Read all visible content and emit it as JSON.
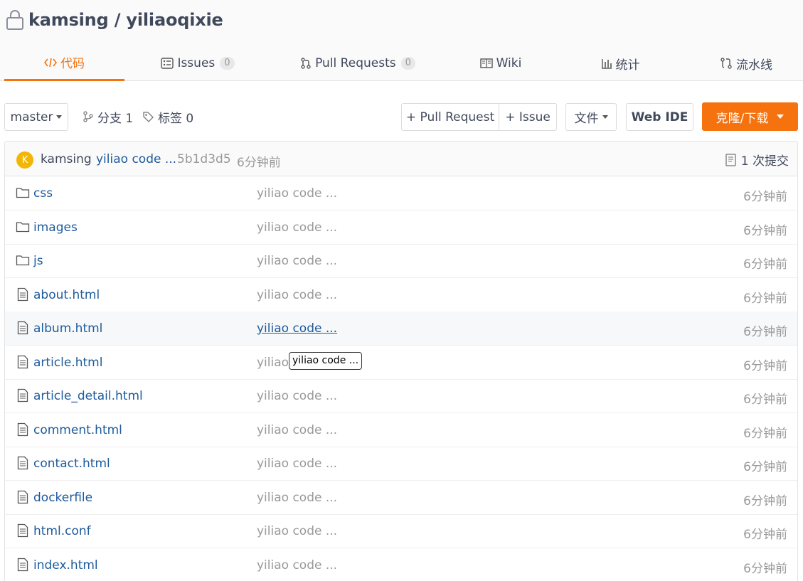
{
  "repo": {
    "title": "kamsing / yiliaoqixie"
  },
  "tabs": [
    {
      "label": "代码",
      "icon": "code-icon",
      "active": true
    },
    {
      "label": "Issues",
      "count": "0",
      "icon": "issues-icon"
    },
    {
      "label": "Pull Requests",
      "count": "0",
      "icon": "pull-request-icon"
    },
    {
      "label": "Wiki",
      "icon": "wiki-icon"
    },
    {
      "label": "统计",
      "icon": "stats-icon"
    },
    {
      "label": "流水线",
      "icon": "pipeline-icon"
    }
  ],
  "toolbar": {
    "branch": "master",
    "branches": "分支 1",
    "tags": "标签 0",
    "new_pr": "+ Pull Request",
    "new_issue": "+ Issue",
    "file": "文件",
    "web_ide": "Web IDE",
    "clone": "克隆/下载"
  },
  "commit": {
    "avatar_letter": "K",
    "author": "kamsing",
    "message": "yiliao code ...",
    "hash": "5b1d3d5",
    "time": "6分钟前",
    "commits": "1 次提交"
  },
  "files": [
    {
      "name": "css",
      "type": "folder",
      "message": "yiliao code ...",
      "time": "6分钟前"
    },
    {
      "name": "images",
      "type": "folder",
      "message": "yiliao code ...",
      "time": "6分钟前"
    },
    {
      "name": "js",
      "type": "folder",
      "message": "yiliao code ...",
      "time": "6分钟前"
    },
    {
      "name": "about.html",
      "type": "file",
      "message": "yiliao code ...",
      "time": "6分钟前"
    },
    {
      "name": "album.html",
      "type": "file",
      "message": "yiliao code ...",
      "time": "6分钟前"
    },
    {
      "name": "article.html",
      "type": "file",
      "message": "yiliao",
      "time": "6分钟前"
    },
    {
      "name": "article_detail.html",
      "type": "file",
      "message": "yiliao code ...",
      "time": "6分钟前"
    },
    {
      "name": "comment.html",
      "type": "file",
      "message": "yiliao code ...",
      "time": "6分钟前"
    },
    {
      "name": "contact.html",
      "type": "file",
      "message": "yiliao code ...",
      "time": "6分钟前"
    },
    {
      "name": "dockerfile",
      "type": "file",
      "message": "yiliao code ...",
      "time": "6分钟前"
    },
    {
      "name": "html.conf",
      "type": "file",
      "message": "yiliao code ...",
      "time": "6分钟前"
    },
    {
      "name": "index.html",
      "type": "file",
      "message": "yiliao code ...",
      "time": "6分钟前"
    }
  ],
  "tooltip": "yiliao code ...",
  "colors": {
    "accent": "#f5720f",
    "link": "#1d5b9c",
    "muted": "#999999"
  }
}
